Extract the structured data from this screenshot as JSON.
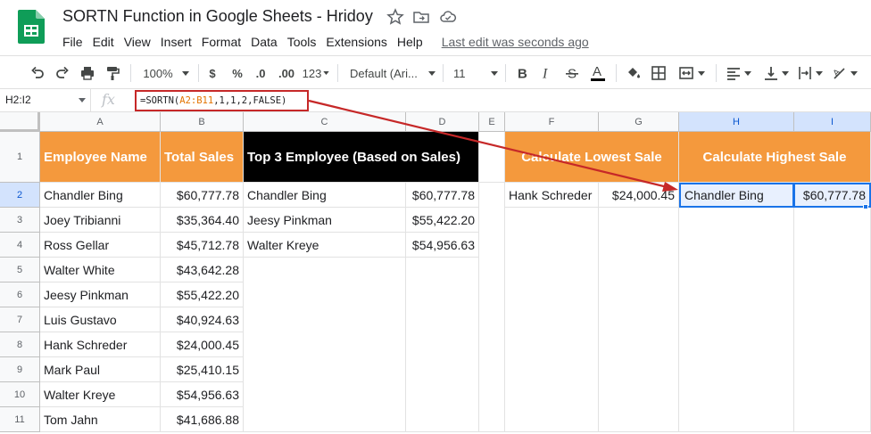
{
  "title_bar": {
    "doc_title": "SORTN Function in Google Sheets - Hridoy",
    "icons": [
      "star-icon",
      "move-to-folder-icon",
      "cloud-status-icon"
    ]
  },
  "menu": {
    "items": [
      "File",
      "Edit",
      "View",
      "Insert",
      "Format",
      "Data",
      "Tools",
      "Extensions",
      "Help"
    ],
    "last_edit": "Last edit was seconds ago"
  },
  "toolbar": {
    "zoom": "100%",
    "currency": "$",
    "percent": "%",
    "decrease_decimals": ".0",
    "increase_decimals": ".00",
    "more_formats": "123",
    "font": "Default (Ari...",
    "font_size": "11",
    "text_color": "#000000"
  },
  "formula_bar": {
    "name_box": "H2:I2",
    "fx": "fx",
    "formula_prefix": "=SORTN(",
    "formula_range": "A2:B11",
    "formula_suffix": ",1,1,2,FALSE)"
  },
  "columns": [
    "A",
    "B",
    "C",
    "D",
    "E",
    "F",
    "G",
    "H",
    "I"
  ],
  "rows": [
    "1",
    "2",
    "3",
    "4",
    "5",
    "6",
    "7",
    "8",
    "9",
    "10",
    "11"
  ],
  "headers": {
    "employee_name": "Employee Name",
    "total_sales": "Total Sales",
    "top3": "Top 3 Employee (Based on Sales)",
    "lowest": "Calculate Lowest Sale",
    "highest": "Calculate Highest Sale"
  },
  "employees": [
    {
      "name": "Chandler Bing",
      "sales": "$60,777.78"
    },
    {
      "name": "Joey Tribianni",
      "sales": "$35,364.40"
    },
    {
      "name": "Ross Gellar",
      "sales": "$45,712.78"
    },
    {
      "name": "Walter White",
      "sales": "$43,642.28"
    },
    {
      "name": "Jeesy Pinkman",
      "sales": "$55,422.20"
    },
    {
      "name": "Luis Gustavo",
      "sales": "$40,924.63"
    },
    {
      "name": "Hank Schreder",
      "sales": "$24,000.45"
    },
    {
      "name": "Mark Paul",
      "sales": "$25,410.15"
    },
    {
      "name": "Walter Kreye",
      "sales": "$54,956.63"
    },
    {
      "name": "Tom Jahn",
      "sales": "$41,686.88"
    }
  ],
  "top3": [
    {
      "name": "Chandler Bing",
      "sales": "$60,777.78"
    },
    {
      "name": "Jeesy Pinkman",
      "sales": "$55,422.20"
    },
    {
      "name": "Walter Kreye",
      "sales": "$54,956.63"
    }
  ],
  "lowest": {
    "name": "Hank Schreder",
    "sales": "$24,000.45"
  },
  "highest": {
    "name": "Chandler Bing",
    "sales": "$60,777.78"
  },
  "colors": {
    "orange_header": "#f4993d",
    "black_header": "#000000",
    "annotation_red": "#c62828",
    "selection_blue": "#1a73e8",
    "sheets_green": "#0f9d58"
  }
}
